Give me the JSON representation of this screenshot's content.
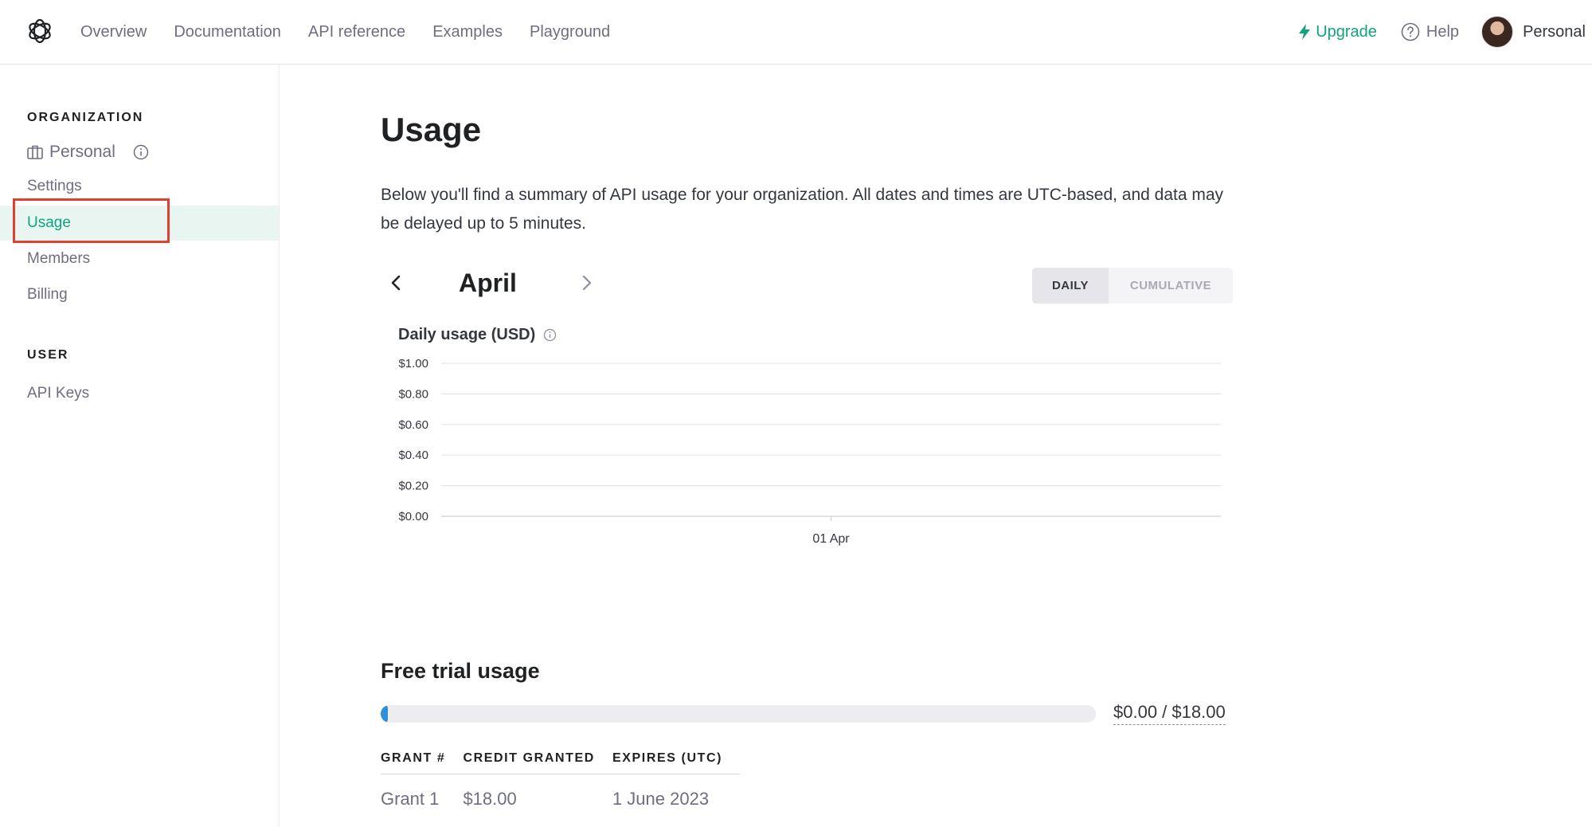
{
  "nav": {
    "links": [
      "Overview",
      "Documentation",
      "API reference",
      "Examples",
      "Playground"
    ],
    "upgrade": "Upgrade",
    "help": "Help",
    "profile": "Personal"
  },
  "sidebar": {
    "org_heading": "ORGANIZATION",
    "org_name": "Personal",
    "items": [
      {
        "label": "Settings"
      },
      {
        "label": "Usage",
        "active": true
      },
      {
        "label": "Members"
      },
      {
        "label": "Billing"
      }
    ],
    "user_heading": "USER",
    "user_items": [
      {
        "label": "API Keys"
      }
    ]
  },
  "main": {
    "title": "Usage",
    "description": "Below you'll find a summary of API usage for your organization. All dates and times are UTC-based, and data may be delayed up to 5 minutes.",
    "month": "April",
    "toggle": {
      "daily": "DAILY",
      "cumulative": "CUMULATIVE",
      "selected": "DAILY"
    },
    "chart_title": "Daily usage (USD)",
    "free_trial": {
      "title": "Free trial usage",
      "used": 0,
      "total": 18,
      "progress_fraction": 0,
      "progress_text": "$0.00 / $18.00",
      "columns": [
        "GRANT #",
        "CREDIT GRANTED",
        "EXPIRES (UTC)"
      ],
      "rows": [
        [
          "Grant 1",
          "$18.00",
          "1 June 2023"
        ]
      ]
    }
  },
  "colors": {
    "accent": "#10a37f",
    "highlight": "#e0402f",
    "progress": "#2f8fd8",
    "active_bg": "#e8f5f1"
  },
  "chart_data": {
    "type": "bar",
    "title": "Daily usage (USD)",
    "categories": [
      "01 Apr"
    ],
    "values": [
      0
    ],
    "y_ticks": [
      "$0.00",
      "$0.20",
      "$0.40",
      "$0.60",
      "$0.80",
      "$1.00"
    ],
    "ylim": [
      0,
      1
    ],
    "grid": true,
    "xlabel": "",
    "ylabel": ""
  }
}
